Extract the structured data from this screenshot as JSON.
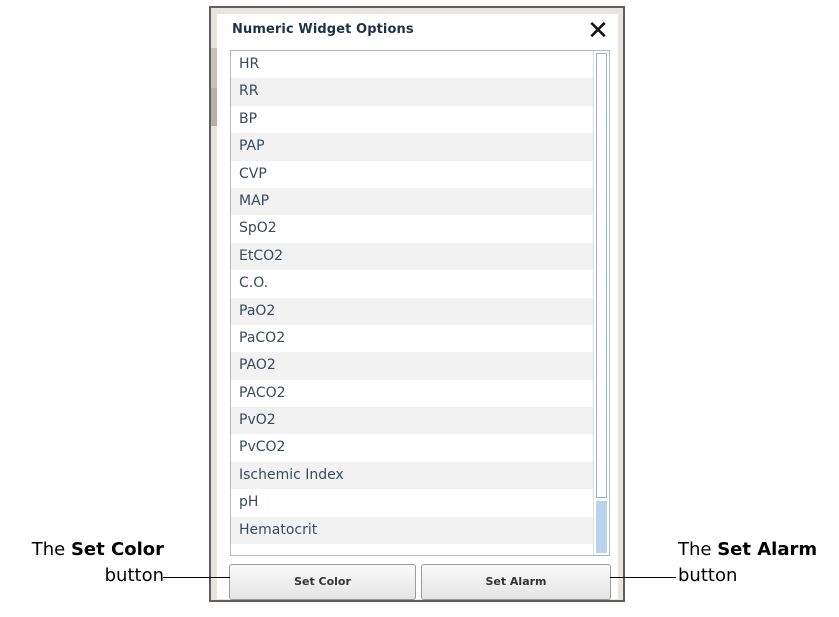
{
  "dialog": {
    "title": "Numeric Widget Options",
    "close_label": "✕"
  },
  "options": [
    "HR",
    "RR",
    "BP",
    "PAP",
    "CVP",
    "MAP",
    "SpO2",
    "EtCO2",
    "C.O.",
    "PaO2",
    "PaCO2",
    "PAO2",
    "PACO2",
    "PvO2",
    "PvCO2",
    "Ischemic Index",
    "pH",
    "Hematocrit"
  ],
  "buttons": {
    "set_color": "Set Color",
    "set_alarm": "Set Alarm"
  },
  "callouts": {
    "left": {
      "prefix": "The ",
      "bold": "Set Color",
      "suffix": "button"
    },
    "right": {
      "prefix": "The ",
      "bold": "Set Alarm",
      "suffix": "button"
    }
  },
  "colors": {
    "title_text": "#1f3346",
    "list_text": "#3b4a5c",
    "scroll_accent": "#b9d3ea"
  }
}
